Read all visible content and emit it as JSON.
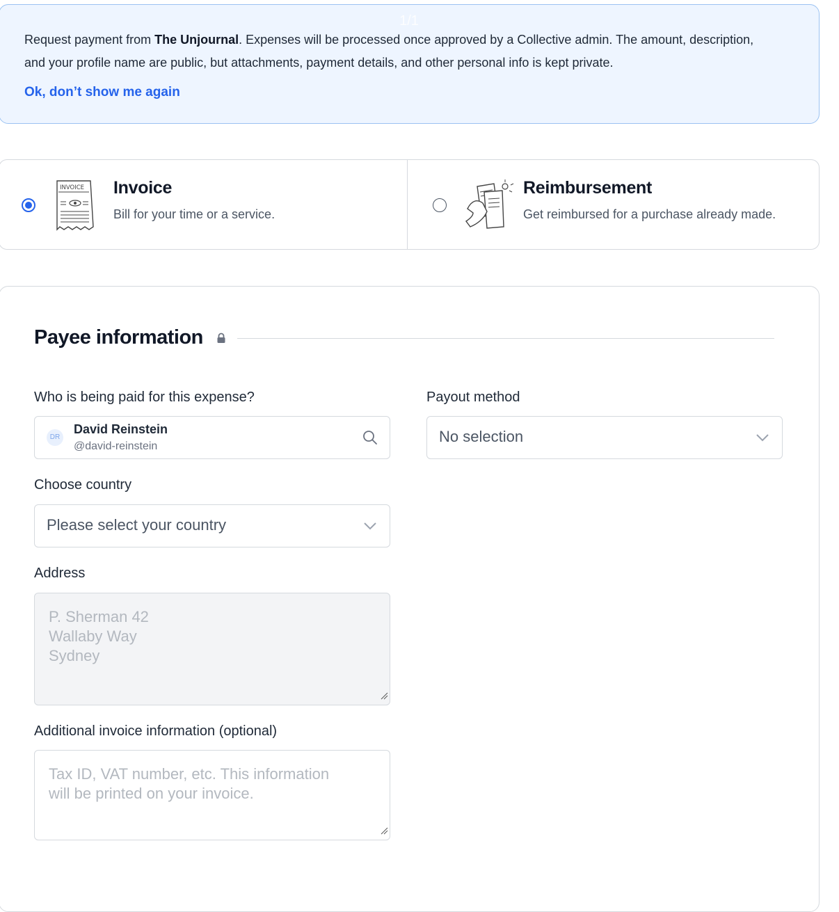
{
  "page_indicator": "1/1",
  "notice": {
    "text_before": "Request payment from ",
    "collective": "The Unjournal",
    "text_after": ". Expenses will be processed once approved by a Collective admin. The amount, description, and your profile name are public, but attachments, payment details, and other personal info is kept private.",
    "dismiss_label": "Ok, don’t show me again"
  },
  "expense_types": [
    {
      "title": "Invoice",
      "description": "Bill for your time or a service.",
      "selected": true,
      "illustration_text": "INVOICE"
    },
    {
      "title": "Reimbursement",
      "description": "Get reimbursed for a purchase already made.",
      "selected": false
    }
  ],
  "payee_section": {
    "title": "Payee information",
    "who_label": "Who is being paid for this expense?",
    "payee": {
      "initials": "DR",
      "name": "David Reinstein",
      "handle": "@david-reinstein"
    },
    "payout_label": "Payout method",
    "payout_value": "No selection",
    "country_label": "Choose country",
    "country_placeholder": "Please select your country",
    "address_label": "Address",
    "address_placeholder": "P. Sherman 42\nWallaby Way\nSydney",
    "additional_label": "Additional invoice information (optional)",
    "additional_placeholder": "Tax ID, VAT number, etc. This information\nwill be printed on your invoice."
  },
  "colors": {
    "accent": "#2563eb",
    "notice_bg": "#eef5ff",
    "border": "#d5d9de"
  },
  "icons": [
    "invoice-illustration",
    "reimbursement-illustration",
    "lock-icon",
    "search-icon",
    "chevron-down-icon",
    "resize-grip-icon"
  ]
}
